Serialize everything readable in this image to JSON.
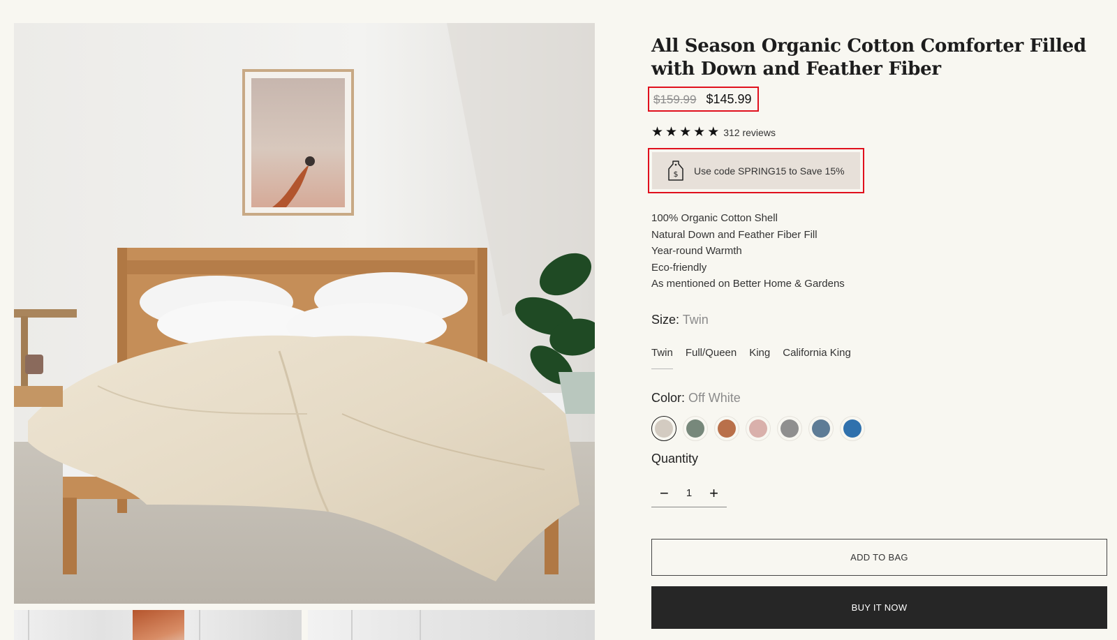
{
  "product": {
    "title": "All Season Organic Cotton Comforter Filled with Down and Feather Fiber",
    "price_original": "$159.99",
    "price_sale": "$145.99",
    "rating_stars": 5,
    "reviews_label": "312 reviews",
    "promo_text": "Use code SPRING15 to Save 15%",
    "features": [
      "100% Organic Cotton Shell",
      "Natural Down and Feather Fiber Fill",
      "Year-round Warmth",
      "Eco-friendly",
      "As mentioned on Better Home & Gardens"
    ]
  },
  "size": {
    "label": "Size:",
    "selected": "Twin",
    "options": [
      "Twin",
      "Full/Queen",
      "King",
      "California King"
    ]
  },
  "color": {
    "label": "Color:",
    "selected": "Off White",
    "swatches": [
      "#d3cbc1",
      "#77887b",
      "#b9704a",
      "#d9b0ab",
      "#8f8f8f",
      "#5e7c96",
      "#3071ad"
    ]
  },
  "quantity": {
    "label": "Quantity",
    "value": "1",
    "minus": "−",
    "plus": "+"
  },
  "buttons": {
    "add_to_bag": "ADD TO BAG",
    "buy_now": "BUY IT NOW"
  },
  "colors": {
    "background": "#f8f7f1",
    "highlight_outline": "#e0101d",
    "promo_bg": "#e7e0d9",
    "buy_button": "#262626"
  }
}
